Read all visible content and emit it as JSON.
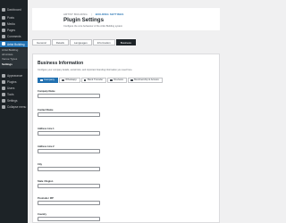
{
  "sidebar": {
    "items": [
      {
        "label": "Dashboard",
        "icon": "dashboard-icon"
      },
      {
        "label": "Posts",
        "icon": "pin-icon"
      },
      {
        "label": "Media",
        "icon": "media-icon"
      },
      {
        "label": "Pages",
        "icon": "page-icon"
      },
      {
        "label": "Comments",
        "icon": "comment-icon"
      },
      {
        "label": "Artist Building",
        "icon": "building-icon",
        "active": true
      },
      {
        "label": "Appearance",
        "icon": "brush-icon"
      },
      {
        "label": "Plugins",
        "icon": "plugin-icon"
      },
      {
        "label": "Users",
        "icon": "users-icon"
      },
      {
        "label": "Tools",
        "icon": "wrench-icon"
      },
      {
        "label": "Settings",
        "icon": "settings-icon"
      },
      {
        "label": "Collapse menu",
        "icon": "collapse-icon"
      }
    ],
    "submenu": [
      {
        "label": "Artist Building"
      },
      {
        "label": "All Artists"
      },
      {
        "label": "Venue Types"
      },
      {
        "label": "Settings",
        "current": true
      }
    ]
  },
  "header": {
    "breadcrumb": [
      "ARTIST BUILDING",
      "BUILDING SETTINGS"
    ],
    "title": "Plugin Settings",
    "subtitle": "Configure the core behaviour of the Artist Building system"
  },
  "tabs": [
    "General",
    "Details",
    "Languages",
    "Information",
    "Business"
  ],
  "active_tab": 4,
  "card": {
    "title": "Business Information",
    "description": "Configure your company details, social links, and important branding information you need here.",
    "subtabs": [
      "Company",
      "Whatsapp",
      "Bank Transfer",
      "Reviews",
      "Membership & Access"
    ],
    "active_subtab": 0,
    "fields": [
      {
        "label": "Company Name",
        "value": "",
        "placeholder": ""
      },
      {
        "label": "Contact Name",
        "value": "",
        "placeholder": ""
      },
      {
        "label": "Address Line 1",
        "value": "",
        "placeholder": ""
      },
      {
        "label": "Address Line 2",
        "value": "",
        "placeholder": ""
      },
      {
        "label": "City",
        "value": "",
        "placeholder": ""
      },
      {
        "label": "State / Region",
        "value": "",
        "placeholder": ""
      },
      {
        "label": "Postcode / ZIP",
        "value": "",
        "placeholder": ""
      },
      {
        "label": "Country",
        "value": "",
        "placeholder": ""
      }
    ]
  },
  "colors": {
    "sidebar_bg": "#1d2327",
    "accent": "#2271b1",
    "tab_active": "#1d2327"
  }
}
